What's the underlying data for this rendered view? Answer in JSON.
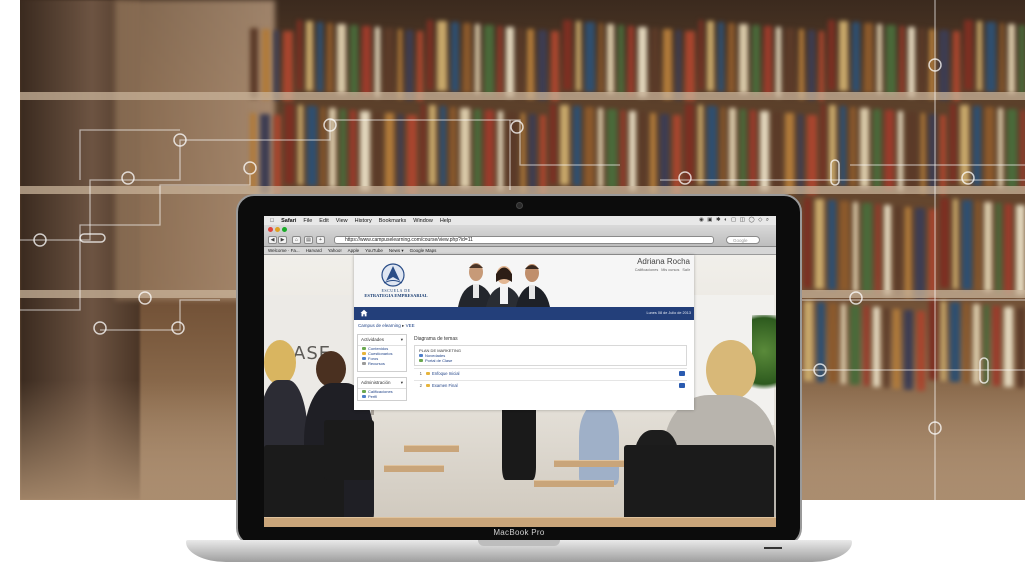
{
  "laptop": {
    "brand_label": "MacBook Pro"
  },
  "mac_menubar": {
    "apple_glyph": "",
    "items": [
      "Safari",
      "File",
      "Edit",
      "View",
      "History",
      "Bookmarks",
      "Window",
      "Help"
    ],
    "status_icons": "◉ ▣ ✱ ◐ ▢ ◫ ◯ ◇ ⌕"
  },
  "browser": {
    "url": "https://www.campuselearning.com/course/view.php?id=11",
    "search_placeholder": "Google",
    "nav_buttons": [
      "◀",
      "▶",
      "⌂",
      "▤",
      "+"
    ],
    "bookmarks": [
      "Welcome · Fa...",
      "Harvard",
      "Yahoo!",
      "Apple",
      "YouTube",
      "News ▾",
      "Google Maps"
    ]
  },
  "classroom": {
    "board_text": "CLASE"
  },
  "lms": {
    "logo_line1": "ESCUELA DE",
    "logo_line2": "ESTRATEGIA EMPRESARIAL",
    "user_name": "Adriana Rocha",
    "user_links": [
      "Calificaciones",
      "Mis cursos",
      "Salir"
    ],
    "nav_date": "Lunes 08 de Julio de 2013",
    "breadcrumb": {
      "root": "Campus de elearning",
      "current": "VEE"
    },
    "activities_block": {
      "title": "Actividades",
      "items": [
        "Contenidos",
        "Cuestionarios",
        "Foros",
        "Recursos"
      ]
    },
    "admin_block": {
      "title": "Administración",
      "items": [
        "Calificaciones",
        "Perfil"
      ]
    },
    "topics": {
      "title": "Diagrama de temas",
      "topic0": {
        "label": "PLAN DE MARKETING",
        "items": [
          "Novedades",
          "Portal de Clase"
        ]
      },
      "rows": [
        {
          "num": "1",
          "label": "Enfoque Inicial"
        },
        {
          "num": "2",
          "label": "Examen Final"
        }
      ]
    }
  }
}
